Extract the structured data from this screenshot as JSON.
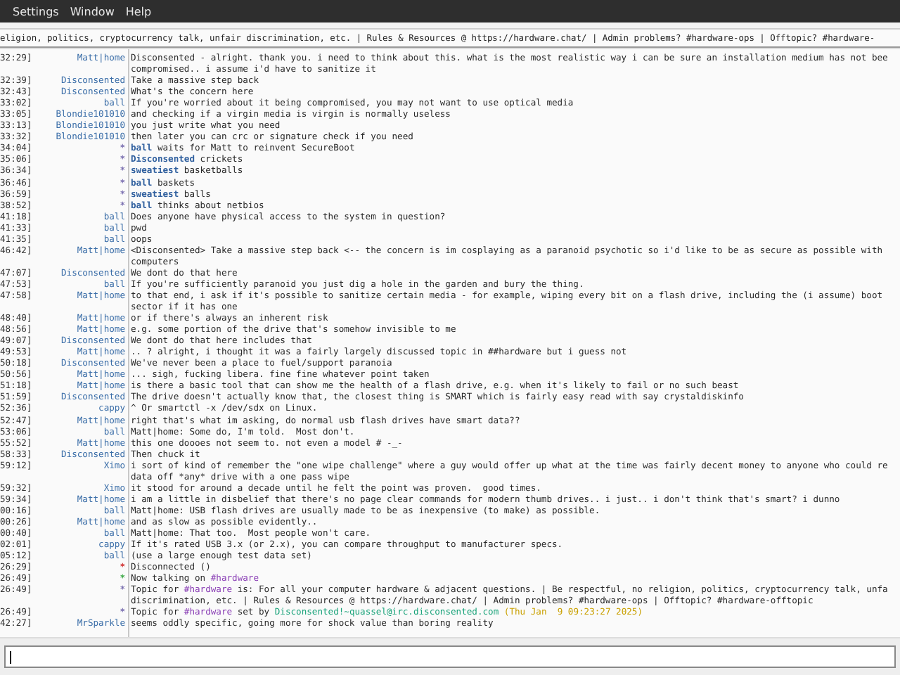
{
  "menu": [
    {
      "label": "Settings"
    },
    {
      "label": "Window"
    },
    {
      "label": "Help"
    }
  ],
  "topic": "eligion, politics, cryptocurrency talk, unfair discrimination, etc. | Rules & Resources @ https://hardware.chat/ | Admin problems? #hardware-ops | Offtopic? #hardware-",
  "messages": [
    {
      "time": "32:29]",
      "kind": "message",
      "nick": "Matt|home",
      "lines": [
        "Disconsented - alright. thank you. i need to think about this. what is the most realistic way i can be sure an installation medium has not bee",
        "compromised.. i assume i'd have to sanitize it"
      ]
    },
    {
      "time": "32:39]",
      "kind": "message",
      "nick": "Disconsented",
      "lines": [
        "Take a massive step back"
      ]
    },
    {
      "time": "32:43]",
      "kind": "message",
      "nick": "Disconsented",
      "lines": [
        "What's the concern here"
      ]
    },
    {
      "time": "33:02]",
      "kind": "message",
      "nick": "ball",
      "lines": [
        "If you're worried about it being compromised, you may not want to use optical media"
      ]
    },
    {
      "time": "33:05]",
      "kind": "message",
      "nick": "Blondie101010",
      "lines": [
        "and checking if a virgin media is virgin is normally useless"
      ]
    },
    {
      "time": "33:13]",
      "kind": "message",
      "nick": "Blondie101010",
      "lines": [
        "you just write what you need"
      ]
    },
    {
      "time": "33:32]",
      "kind": "message",
      "nick": "Blondie101010",
      "lines": [
        "then later you can crc or signature check if you need"
      ]
    },
    {
      "time": "34:04]",
      "kind": "action",
      "marker": "*",
      "color": "#7a6fb0",
      "nick": "ball",
      "lines": [
        "waits for Matt to reinvent SecureBoot"
      ]
    },
    {
      "time": "35:06]",
      "kind": "action",
      "marker": "*",
      "color": "#7a6fb0",
      "nick": "Disconsented",
      "lines": [
        "crickets"
      ]
    },
    {
      "time": "36:34]",
      "kind": "action",
      "marker": "*",
      "color": "#7a6fb0",
      "nick": "sweatiest",
      "lines": [
        "basketballs"
      ]
    },
    {
      "time": "36:46]",
      "kind": "action",
      "marker": "*",
      "color": "#7a6fb0",
      "nick": "ball",
      "lines": [
        "baskets"
      ]
    },
    {
      "time": "36:59]",
      "kind": "action",
      "marker": "*",
      "color": "#7a6fb0",
      "nick": "sweatiest",
      "lines": [
        "balls"
      ]
    },
    {
      "time": "38:52]",
      "kind": "action",
      "marker": "*",
      "color": "#7a6fb0",
      "nick": "ball",
      "lines": [
        "thinks about netbios"
      ]
    },
    {
      "time": "41:18]",
      "kind": "message",
      "nick": "ball",
      "lines": [
        "Does anyone have physical access to the system in question?"
      ]
    },
    {
      "time": "41:33]",
      "kind": "message",
      "nick": "ball",
      "lines": [
        "pwd"
      ]
    },
    {
      "time": "41:35]",
      "kind": "message",
      "nick": "ball",
      "lines": [
        "oops"
      ]
    },
    {
      "time": "46:42]",
      "kind": "message",
      "nick": "Matt|home",
      "lines": [
        "<Disconsented> Take a massive step back <-- the concern is im cosplaying as a paranoid psychotic so i'd like to be as secure as possible with",
        "computers"
      ]
    },
    {
      "time": "47:07]",
      "kind": "message",
      "nick": "Disconsented",
      "lines": [
        "We dont do that here"
      ]
    },
    {
      "time": "47:53]",
      "kind": "message",
      "nick": "ball",
      "lines": [
        "If you're sufficiently paranoid you just dig a hole in the garden and bury the thing."
      ]
    },
    {
      "time": "47:58]",
      "kind": "message",
      "nick": "Matt|home",
      "lines": [
        "to that end, i ask if it's possible to sanitize certain media - for example, wiping every bit on a flash drive, including the (i assume) boot",
        "sector if it has one"
      ]
    },
    {
      "time": "48:40]",
      "kind": "message",
      "nick": "Matt|home",
      "lines": [
        "or if there's always an inherent risk"
      ]
    },
    {
      "time": "48:56]",
      "kind": "message",
      "nick": "Matt|home",
      "lines": [
        "e.g. some portion of the drive that's somehow invisible to me"
      ]
    },
    {
      "time": "49:07]",
      "kind": "message",
      "nick": "Disconsented",
      "lines": [
        "We dont do that here includes that"
      ]
    },
    {
      "time": "49:53]",
      "kind": "message",
      "nick": "Matt|home",
      "lines": [
        ".. ? alright, i thought it was a fairly largely discussed topic in ##hardware but i guess not"
      ]
    },
    {
      "time": "50:18]",
      "kind": "message",
      "nick": "Disconsented",
      "lines": [
        "We've never been a place to fuel/support paranoia"
      ]
    },
    {
      "time": "50:56]",
      "kind": "message",
      "nick": "Matt|home",
      "lines": [
        "... sigh, fucking libera. fine fine whatever point taken"
      ]
    },
    {
      "time": "51:18]",
      "kind": "message",
      "nick": "Matt|home",
      "lines": [
        "is there a basic tool that can show me the health of a flash drive, e.g. when it's likely to fail or no such beast"
      ]
    },
    {
      "time": "51:59]",
      "kind": "message",
      "nick": "Disconsented",
      "lines": [
        "The drive doesn't actually know that, the closest thing is SMART which is fairly easy read with say crystaldiskinfo"
      ]
    },
    {
      "time": "52:36]",
      "kind": "message",
      "nick": "cappy",
      "lines": [
        "^ Or smartctl -x /dev/sdx on Linux."
      ]
    },
    {
      "time": "52:47]",
      "kind": "message",
      "nick": "Matt|home",
      "lines": [
        "right that's what im asking, do normal usb flash drives have smart data??"
      ]
    },
    {
      "time": "53:06]",
      "kind": "message",
      "nick": "ball",
      "lines": [
        "Matt|home: Some do, I'm told.  Most don't."
      ]
    },
    {
      "time": "55:52]",
      "kind": "message",
      "nick": "Matt|home",
      "lines": [
        "this one doooes not seem to. not even a model # -_-"
      ]
    },
    {
      "time": "58:33]",
      "kind": "message",
      "nick": "Disconsented",
      "lines": [
        "Then chuck it"
      ]
    },
    {
      "time": "59:12]",
      "kind": "message",
      "nick": "Ximo",
      "lines": [
        "i sort of kind of remember the \"one wipe challenge\" where a guy would offer up what at the time was fairly decent money to anyone who could re",
        "data off *any* drive with a one pass wipe"
      ]
    },
    {
      "time": "59:32]",
      "kind": "message",
      "nick": "Ximo",
      "lines": [
        "it stood for around a decade until he felt the point was proven.  good times."
      ]
    },
    {
      "time": "59:34]",
      "kind": "message",
      "nick": "Matt|home",
      "lines": [
        "i am a little in disbelief that there's no page clear commands for modern thumb drives.. i just.. i don't think that's smart? i dunno"
      ]
    },
    {
      "time": "00:16]",
      "kind": "message",
      "nick": "ball",
      "lines": [
        "Matt|home: USB flash drives are usually made to be as inexpensive (to make) as possible."
      ]
    },
    {
      "time": "00:26]",
      "kind": "message",
      "nick": "Matt|home",
      "lines": [
        "and as slow as possible evidently.."
      ]
    },
    {
      "time": "00:40]",
      "kind": "message",
      "nick": "ball",
      "lines": [
        "Matt|home: That too.  Most people won't care."
      ]
    },
    {
      "time": "02:01]",
      "kind": "message",
      "nick": "cappy",
      "lines": [
        "If it's rated USB 3.x (or 2.x), you can compare throughput to manufacturer specs."
      ]
    },
    {
      "time": "05:12]",
      "kind": "message",
      "nick": "ball",
      "lines": [
        "(use a large enough test data set)"
      ]
    },
    {
      "time": "26:29]",
      "kind": "status",
      "marker": "*",
      "color": "#d03030",
      "lines": [
        [
          {
            "kind": "plain",
            "text": "Disconnected ()"
          }
        ]
      ]
    },
    {
      "time": "26:49]",
      "kind": "status",
      "marker": "*",
      "color": "#3aa845",
      "lines": [
        [
          {
            "kind": "plain",
            "text": "Now talking on "
          },
          {
            "kind": "channel",
            "text": "#hardware"
          }
        ]
      ]
    },
    {
      "time": "26:49]",
      "kind": "status",
      "marker": "*",
      "color": "#7a6fb0",
      "lines": [
        [
          {
            "kind": "plain",
            "text": "Topic for "
          },
          {
            "kind": "channel",
            "text": "#hardware"
          },
          {
            "kind": "plain",
            "text": " is: For all your computer hardware & adjacent questions. | Be respectful, no religion, politics, cryptocurrency talk, unfa"
          }
        ],
        [
          {
            "kind": "plain",
            "text": "discrimination, etc. | Rules & Resources @ https://hardware.chat/ | Admin problems? #hardware-ops | Offtopic? #hardware-offtopic"
          }
        ]
      ]
    },
    {
      "time": "26:49]",
      "kind": "status",
      "marker": "*",
      "color": "#7a6fb0",
      "lines": [
        [
          {
            "kind": "plain",
            "text": "Topic for "
          },
          {
            "kind": "channel",
            "text": "#hardware"
          },
          {
            "kind": "plain",
            "text": " set by "
          },
          {
            "kind": "host",
            "text": "Disconsented!~quassel@irc.disconsented.com"
          },
          {
            "kind": "date",
            "text": " (Thu Jan  9 09:23:27 2025)"
          }
        ]
      ]
    },
    {
      "time": "42:27]",
      "kind": "message",
      "nick": "MrSparkle",
      "lines": [
        "seems oddly specific, going more for shock value than boring reality"
      ]
    }
  ]
}
